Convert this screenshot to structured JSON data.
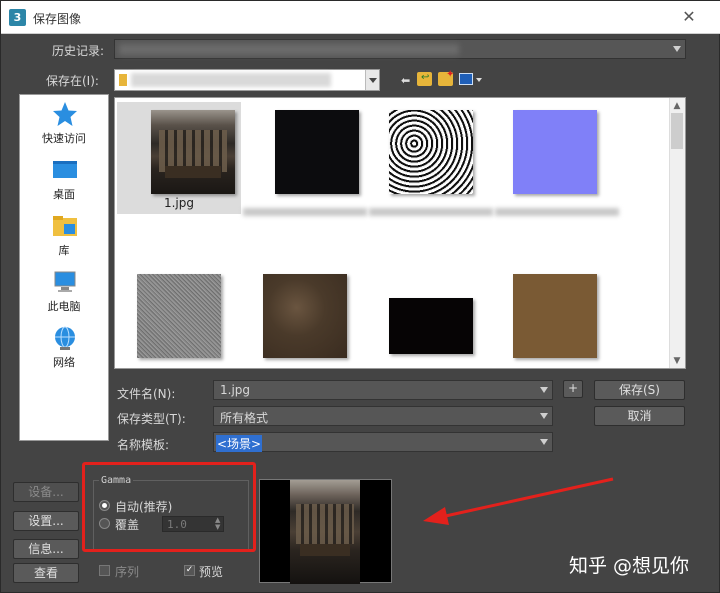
{
  "window": {
    "title": "保存图像",
    "app_icon": "3"
  },
  "history": {
    "label": "历史记录:"
  },
  "save_in": {
    "label": "保存在(I):"
  },
  "places": [
    {
      "label": "快速访问",
      "icon": "star-icon"
    },
    {
      "label": "桌面",
      "icon": "desktop-icon"
    },
    {
      "label": "库",
      "icon": "library-folder-icon"
    },
    {
      "label": "此电脑",
      "icon": "computer-icon"
    },
    {
      "label": "网络",
      "icon": "network-globe-icon"
    }
  ],
  "files": [
    {
      "name": "1.jpg",
      "selected": true
    },
    {
      "name": "",
      "selected": false
    },
    {
      "name": "",
      "selected": false
    },
    {
      "name": "",
      "selected": false
    },
    {
      "name": "",
      "selected": false
    },
    {
      "name": "",
      "selected": false
    },
    {
      "name": "",
      "selected": false
    },
    {
      "name": "",
      "selected": false
    }
  ],
  "form": {
    "filename_label": "文件名(N):",
    "filename_value": "1.jpg",
    "filetype_label": "保存类型(T):",
    "filetype_value": "所有格式",
    "template_label": "名称模板:",
    "template_value": "<场景>",
    "plus_label": "+",
    "save_label": "保存(S)",
    "cancel_label": "取消"
  },
  "left_buttons": {
    "settings_disabled": "设备...",
    "settings": "设置...",
    "info": "信息...",
    "view": "查看"
  },
  "gamma": {
    "title": "Gamma",
    "auto_label": "自动(推荐)",
    "override_label": "覆盖",
    "override_value": "1.0"
  },
  "options": {
    "sequence_label": "序列",
    "preview_label": "预览"
  },
  "watermark": "知乎 @想见你",
  "colors": {
    "highlight_box": "#e3211c",
    "accent_arrow": "#e3211c"
  }
}
